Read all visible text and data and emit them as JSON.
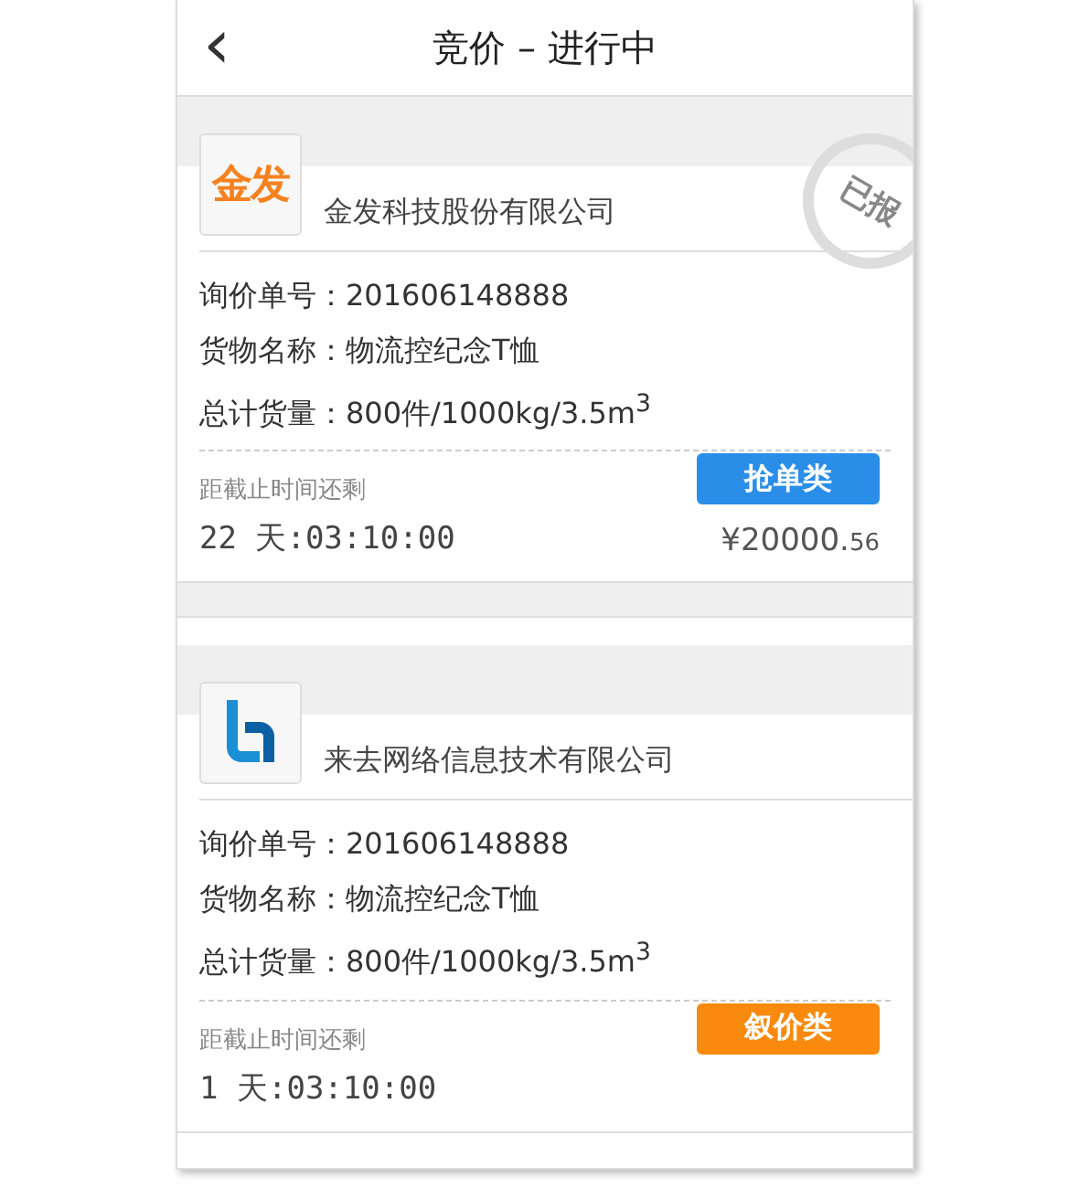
{
  "header": {
    "back": "‹",
    "title": "竞价 – 进行中"
  },
  "cards": [
    {
      "logo": {
        "kind": "text",
        "text": "金发"
      },
      "company": "金发科技股份有限公司",
      "stamp": "已报",
      "fields": [
        {
          "label": "询价单号：",
          "value": "201606148888"
        },
        {
          "label": "货物名称：",
          "value": "物流控纪念T恤"
        },
        {
          "label": "总计货量：",
          "value": "800件/1000kg/3.5m$^{3}$"
        }
      ],
      "tag": {
        "label": "抢单类",
        "color": "#2a8ee8"
      },
      "countdown_label": "距截止时间还剩",
      "countdown": "22 天:03:10:00",
      "price": {
        "main": "¥20000.",
        "cents": "56"
      }
    },
    {
      "logo": {
        "kind": "mark"
      },
      "company": "来去网络信息技术有限公司",
      "fields": [
        {
          "label": "询价单号：",
          "value": "201606148888"
        },
        {
          "label": "货物名称：",
          "value": "物流控纪念T恤"
        },
        {
          "label": "总计货量：",
          "value": "800件/1000kg/3.5m$^{3}$"
        }
      ],
      "tag": {
        "label": "叙价类",
        "color": "#fa8a0e"
      },
      "countdown_label": "距截止时间还剩",
      "countdown": "1 天:03:10:00"
    }
  ]
}
